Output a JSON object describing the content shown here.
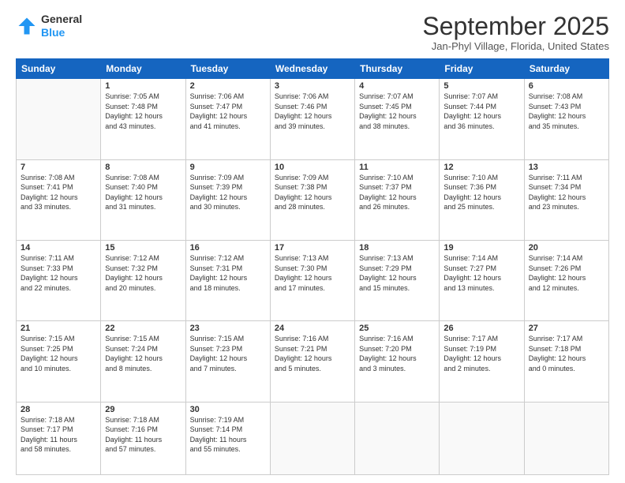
{
  "header": {
    "logo": {
      "general": "General",
      "blue": "Blue"
    },
    "title": "September 2025",
    "location": "Jan-Phyl Village, Florida, United States"
  },
  "days_of_week": [
    "Sunday",
    "Monday",
    "Tuesday",
    "Wednesday",
    "Thursday",
    "Friday",
    "Saturday"
  ],
  "weeks": [
    [
      {
        "day": "",
        "info": ""
      },
      {
        "day": "1",
        "info": "Sunrise: 7:05 AM\nSunset: 7:48 PM\nDaylight: 12 hours\nand 43 minutes."
      },
      {
        "day": "2",
        "info": "Sunrise: 7:06 AM\nSunset: 7:47 PM\nDaylight: 12 hours\nand 41 minutes."
      },
      {
        "day": "3",
        "info": "Sunrise: 7:06 AM\nSunset: 7:46 PM\nDaylight: 12 hours\nand 39 minutes."
      },
      {
        "day": "4",
        "info": "Sunrise: 7:07 AM\nSunset: 7:45 PM\nDaylight: 12 hours\nand 38 minutes."
      },
      {
        "day": "5",
        "info": "Sunrise: 7:07 AM\nSunset: 7:44 PM\nDaylight: 12 hours\nand 36 minutes."
      },
      {
        "day": "6",
        "info": "Sunrise: 7:08 AM\nSunset: 7:43 PM\nDaylight: 12 hours\nand 35 minutes."
      }
    ],
    [
      {
        "day": "7",
        "info": "Sunrise: 7:08 AM\nSunset: 7:41 PM\nDaylight: 12 hours\nand 33 minutes."
      },
      {
        "day": "8",
        "info": "Sunrise: 7:08 AM\nSunset: 7:40 PM\nDaylight: 12 hours\nand 31 minutes."
      },
      {
        "day": "9",
        "info": "Sunrise: 7:09 AM\nSunset: 7:39 PM\nDaylight: 12 hours\nand 30 minutes."
      },
      {
        "day": "10",
        "info": "Sunrise: 7:09 AM\nSunset: 7:38 PM\nDaylight: 12 hours\nand 28 minutes."
      },
      {
        "day": "11",
        "info": "Sunrise: 7:10 AM\nSunset: 7:37 PM\nDaylight: 12 hours\nand 26 minutes."
      },
      {
        "day": "12",
        "info": "Sunrise: 7:10 AM\nSunset: 7:36 PM\nDaylight: 12 hours\nand 25 minutes."
      },
      {
        "day": "13",
        "info": "Sunrise: 7:11 AM\nSunset: 7:34 PM\nDaylight: 12 hours\nand 23 minutes."
      }
    ],
    [
      {
        "day": "14",
        "info": "Sunrise: 7:11 AM\nSunset: 7:33 PM\nDaylight: 12 hours\nand 22 minutes."
      },
      {
        "day": "15",
        "info": "Sunrise: 7:12 AM\nSunset: 7:32 PM\nDaylight: 12 hours\nand 20 minutes."
      },
      {
        "day": "16",
        "info": "Sunrise: 7:12 AM\nSunset: 7:31 PM\nDaylight: 12 hours\nand 18 minutes."
      },
      {
        "day": "17",
        "info": "Sunrise: 7:13 AM\nSunset: 7:30 PM\nDaylight: 12 hours\nand 17 minutes."
      },
      {
        "day": "18",
        "info": "Sunrise: 7:13 AM\nSunset: 7:29 PM\nDaylight: 12 hours\nand 15 minutes."
      },
      {
        "day": "19",
        "info": "Sunrise: 7:14 AM\nSunset: 7:27 PM\nDaylight: 12 hours\nand 13 minutes."
      },
      {
        "day": "20",
        "info": "Sunrise: 7:14 AM\nSunset: 7:26 PM\nDaylight: 12 hours\nand 12 minutes."
      }
    ],
    [
      {
        "day": "21",
        "info": "Sunrise: 7:15 AM\nSunset: 7:25 PM\nDaylight: 12 hours\nand 10 minutes."
      },
      {
        "day": "22",
        "info": "Sunrise: 7:15 AM\nSunset: 7:24 PM\nDaylight: 12 hours\nand 8 minutes."
      },
      {
        "day": "23",
        "info": "Sunrise: 7:15 AM\nSunset: 7:23 PM\nDaylight: 12 hours\nand 7 minutes."
      },
      {
        "day": "24",
        "info": "Sunrise: 7:16 AM\nSunset: 7:21 PM\nDaylight: 12 hours\nand 5 minutes."
      },
      {
        "day": "25",
        "info": "Sunrise: 7:16 AM\nSunset: 7:20 PM\nDaylight: 12 hours\nand 3 minutes."
      },
      {
        "day": "26",
        "info": "Sunrise: 7:17 AM\nSunset: 7:19 PM\nDaylight: 12 hours\nand 2 minutes."
      },
      {
        "day": "27",
        "info": "Sunrise: 7:17 AM\nSunset: 7:18 PM\nDaylight: 12 hours\nand 0 minutes."
      }
    ],
    [
      {
        "day": "28",
        "info": "Sunrise: 7:18 AM\nSunset: 7:17 PM\nDaylight: 11 hours\nand 58 minutes."
      },
      {
        "day": "29",
        "info": "Sunrise: 7:18 AM\nSunset: 7:16 PM\nDaylight: 11 hours\nand 57 minutes."
      },
      {
        "day": "30",
        "info": "Sunrise: 7:19 AM\nSunset: 7:14 PM\nDaylight: 11 hours\nand 55 minutes."
      },
      {
        "day": "",
        "info": ""
      },
      {
        "day": "",
        "info": ""
      },
      {
        "day": "",
        "info": ""
      },
      {
        "day": "",
        "info": ""
      }
    ]
  ]
}
